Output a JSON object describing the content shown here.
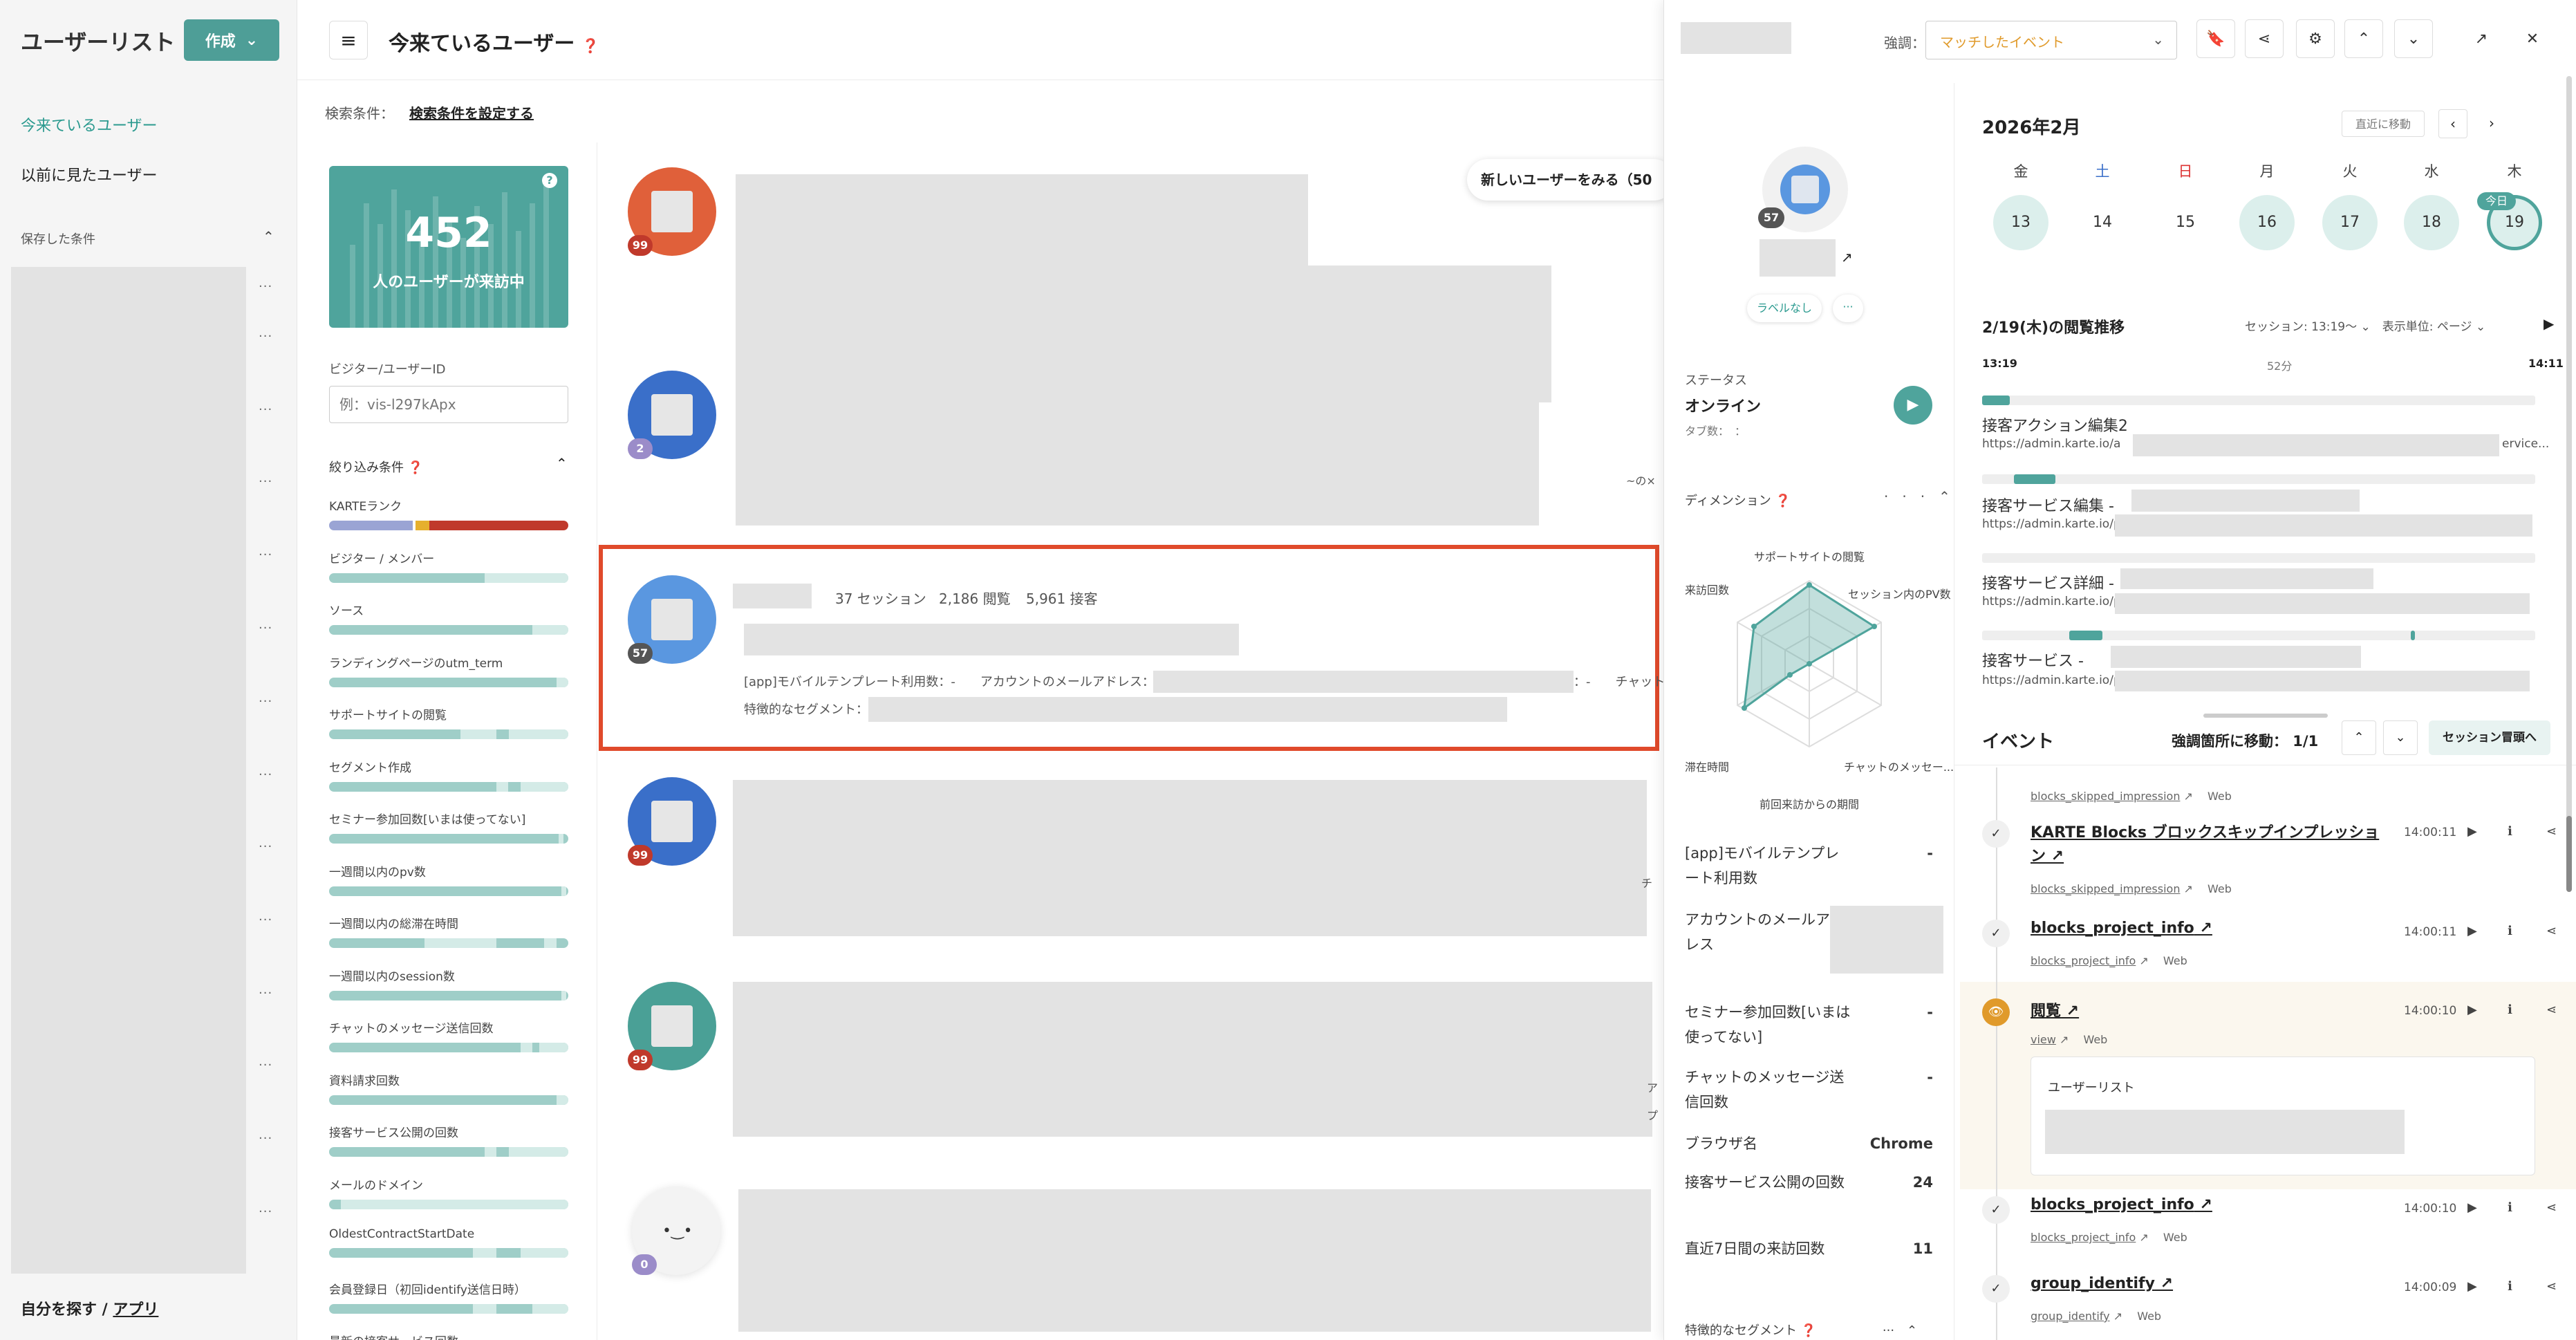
{
  "sidebar": {
    "title": "ユーザーリスト",
    "create_label": "作成",
    "nav": [
      "今来ているユーザー",
      "以前に見たユーザー"
    ],
    "saved_label": "保存した条件",
    "footer_prefix": "自分を探す / ",
    "footer_link": "アプリ"
  },
  "header": {
    "title": "今来ているユーザー",
    "cond_label": "検索条件：",
    "cond_link": "検索条件を設定する"
  },
  "filters": {
    "count": "452",
    "count_label": "人のユーザーが来訪中",
    "visitor_id_label": "ビジター/ユーザーID",
    "visitor_id_placeholder": "例：vis-l297kApx",
    "section_title": "絞り込み条件",
    "rows": [
      "KARTEランク",
      "ビジター / メンバー",
      "ソース",
      "ランディングページのutm_term",
      "サポートサイトの閲覧",
      "セグメント作成",
      "セミナー参加回数[いまは使ってない]",
      "一週間以内のpv数",
      "一週間以内の総滞在時間",
      "一週間以内のsession数",
      "チャットのメッセージ送信回数",
      "資料請求回数",
      "接客サービス公開の回数",
      "メールのドメイン",
      "OldestContractStartDate",
      "会員登録日（初回identify送信日時）",
      "最新の接客サービス回数"
    ]
  },
  "userlist": {
    "new_users_label": "新しいユーザーをみる（50",
    "users": [
      {
        "badge": "99",
        "color": "#e0603a"
      },
      {
        "badge": "2",
        "color": "#3a6fc9"
      },
      {
        "badge": "57",
        "color": "#5a97e0"
      },
      {
        "badge": "99",
        "color": "#3a6fc9"
      },
      {
        "badge": "99",
        "color": "#4aa096"
      },
      {
        "badge": "0",
        "color": "#f3f3f3"
      }
    ],
    "selected": {
      "sessions": "37 セッション",
      "views": "2,186 閲覧",
      "actions": "5,961 接客",
      "attr_line": "[app]モバイルテンプレート利用数：-　　アカウントのメールアドレス：",
      "attr_tail": "：-　　チャット",
      "segment_label": "特徴的なセグメント："
    },
    "side_text_1": "~の×",
    "side_text_2": "チ",
    "side_text_3": "ア",
    "side_text_4": "プ"
  },
  "detail": {
    "emphasis_label": "強調：",
    "emphasis_value": "マッチしたイベント",
    "profile": {
      "badge": "57",
      "no_label": "ラベルなし",
      "more": "···",
      "status_label": "ステータス",
      "status_value": "オンライン",
      "tabs_label": "タブ数：　：",
      "dimension_label": "ディメンション",
      "radar_labels": [
        "サポートサイトの閲覧",
        "セッション内のPV数",
        "チャットのメッセー...",
        "前回来訪からの期間",
        "滞在時間",
        "来訪回数"
      ],
      "attrs": [
        {
          "k": "[app]モバイルテンプレート利用数",
          "v": "-"
        },
        {
          "k": "アカウントのメールアドレス",
          "v": ""
        },
        {
          "k": "セミナー参加回数[いまは使ってない]",
          "v": "-"
        },
        {
          "k": "チャットのメッセージ送信回数",
          "v": "-"
        },
        {
          "k": "ブラウザ名",
          "v": "Chrome"
        },
        {
          "k": "接客サービス公開の回数",
          "v": "24"
        },
        {
          "k": "直近7日間の来訪回数",
          "v": "11"
        }
      ],
      "segment_label": "特徴的なセグメント"
    },
    "calendar": {
      "month": "2026年2月",
      "recent": "直近に移動",
      "dow": [
        "金",
        "土",
        "日",
        "月",
        "火",
        "水",
        "木"
      ],
      "days": [
        "13",
        "14",
        "15",
        "16",
        "17",
        "18",
        "19"
      ],
      "today": "今日"
    },
    "history": {
      "title": "2/19(木)の閲覧推移",
      "session_label": "セッション: 13:19～ ⌄　表示単位: ページ ⌄",
      "start": "13:19",
      "mid": "52分",
      "end": "14:11",
      "pages": [
        {
          "title": "接客アクション編集2",
          "url": "https://admin.karte.io/a"
        },
        {
          "title": "接客サービス編集 - ",
          "url": "https://admin.karte.io/p/"
        },
        {
          "title": "接客サービス詳細 - ",
          "url": "https://admin.karte.io/p/"
        },
        {
          "title": "接客サービス - ",
          "url": "https://admin.karte.io/p/"
        }
      ],
      "url_tail": "ervice..."
    },
    "events": {
      "title": "イベント",
      "move_label": "強調箇所に移動：  1/1",
      "session_btn": "セッション冒頭へ",
      "items": [
        {
          "name": "",
          "sub": "blocks_skipped_impression",
          "src": "Web",
          "time": ""
        },
        {
          "name": "KARTE Blocks ブロックスキップインプレッショ",
          "name2": "ン",
          "sub": "blocks_skipped_impression",
          "src": "Web",
          "time": "14:00:11"
        },
        {
          "name": "blocks_project_info",
          "sub": "blocks_project_info",
          "src": "Web",
          "time": "14:00:11"
        },
        {
          "name": "閲覧",
          "sub": "view",
          "src": "Web",
          "time": "14:00:10"
        },
        {
          "name": "blocks_project_info",
          "sub": "blocks_project_info",
          "src": "Web",
          "time": "14:00:10"
        },
        {
          "name": "group_identify",
          "sub": "group_identify",
          "src": "Web",
          "time": "14:00:09"
        }
      ],
      "card_title": "ユーザーリスト"
    }
  }
}
